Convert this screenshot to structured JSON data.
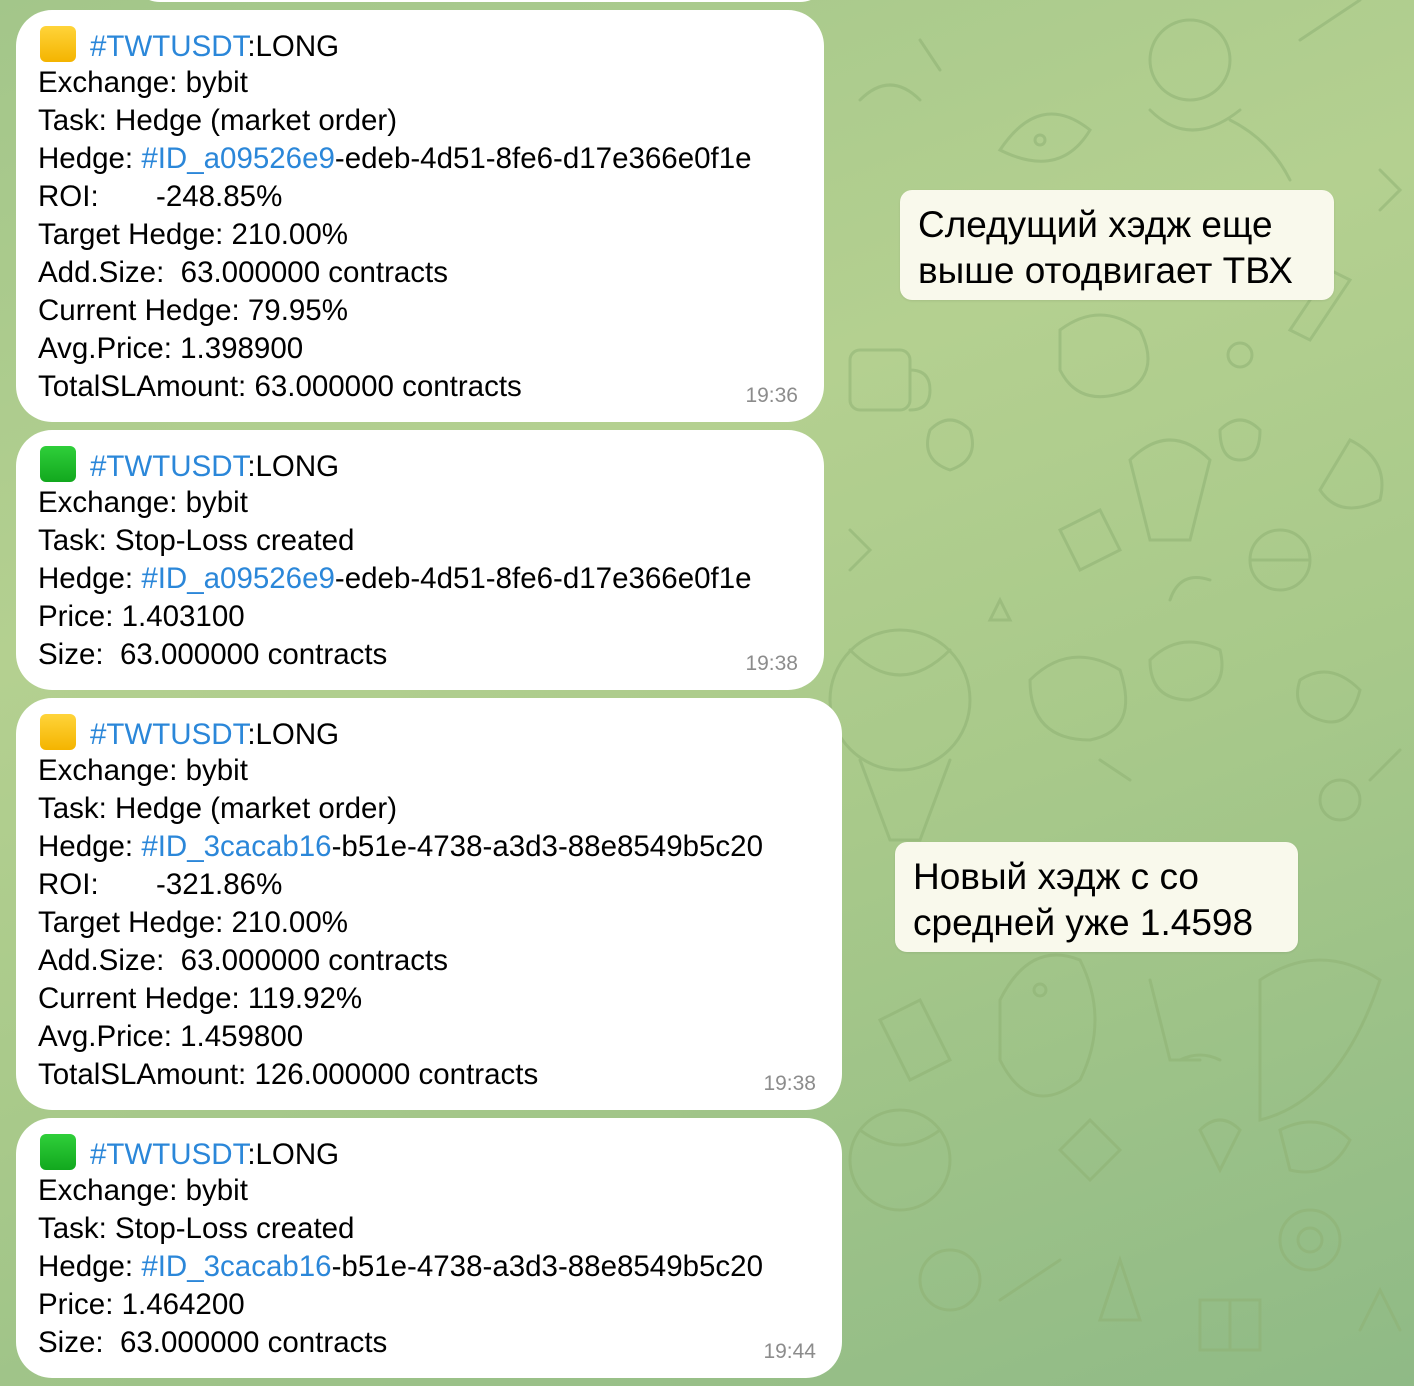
{
  "messages": [
    {
      "status_color": "yellow",
      "status_icon": "yellow-square",
      "tag": "#TWTUSDT",
      "side": ":LONG",
      "exchange": "Exchange: bybit",
      "task": "Task: Hedge (market order)",
      "hedge_label": "Hedge: ",
      "hedge_link": "#ID_a09526e9",
      "hedge_rest": "-edeb-4d51-8fe6-d17e366e0f1e",
      "roi": "ROI:       -248.85%",
      "target": "Target Hedge: 210.00%",
      "add_size": "Add.Size:  63.000000 contracts",
      "current": "Current Hedge: 79.95%",
      "avg_price": "Avg.Price: 1.398900",
      "total_sl": "TotalSLAmount: 63.000000 contracts",
      "time": "19:36"
    },
    {
      "status_color": "green",
      "status_icon": "green-square",
      "tag": "#TWTUSDT",
      "side": ":LONG",
      "exchange": "Exchange: bybit",
      "task": "Task: Stop-Loss created",
      "hedge_label": "Hedge: ",
      "hedge_link": "#ID_a09526e9",
      "hedge_rest": "-edeb-4d51-8fe6-d17e366e0f1e",
      "price": "Price: 1.403100",
      "size": "Size:  63.000000 contracts",
      "time": "19:38"
    },
    {
      "status_color": "yellow",
      "status_icon": "yellow-square",
      "tag": "#TWTUSDT",
      "side": ":LONG",
      "exchange": "Exchange: bybit",
      "task": "Task: Hedge (market order)",
      "hedge_label": "Hedge: ",
      "hedge_link": "#ID_3cacab16",
      "hedge_rest": "-b51e-4738-a3d3-88e8549b5c20",
      "roi": "ROI:       -321.86%",
      "target": "Target Hedge: 210.00%",
      "add_size": "Add.Size:  63.000000 contracts",
      "current": "Current Hedge: 119.92%",
      "avg_price": "Avg.Price: 1.459800",
      "total_sl": "TotalSLAmount: 126.000000 contracts",
      "time": "19:38"
    },
    {
      "status_color": "green",
      "status_icon": "green-square",
      "tag": "#TWTUSDT",
      "side": ":LONG",
      "exchange": "Exchange: bybit",
      "task": "Task: Stop-Loss created",
      "hedge_label": "Hedge: ",
      "hedge_link": "#ID_3cacab16",
      "hedge_rest": "-b51e-4738-a3d3-88e8549b5c20",
      "price": "Price: 1.464200",
      "size": "Size:  63.000000 contracts",
      "time": "19:44"
    }
  ],
  "annotations": [
    {
      "line1": "Следущий хэдж еще",
      "line2": "выше отодвигает ТВХ"
    },
    {
      "line1": "Новый хэдж с со",
      "line2": "средней уже 1.4598"
    }
  ],
  "colors": {
    "link": "#2b87d9",
    "time": "#8c8c8c",
    "bubble": "#ffffff",
    "note_bg": "#f9f9ec",
    "background": "#a8c98a"
  }
}
